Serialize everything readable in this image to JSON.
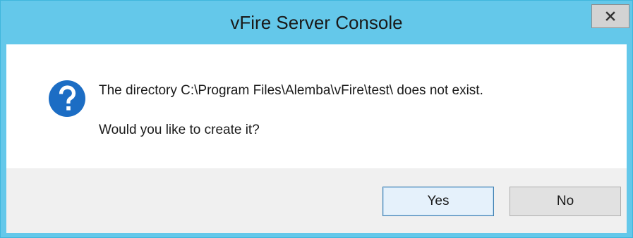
{
  "window": {
    "title": "vFire Server Console",
    "close_icon": "close-icon"
  },
  "dialog": {
    "icon": "question-icon",
    "message": "The directory C:\\Program Files\\Alemba\\vFire\\test\\ does not exist.",
    "question": "Would you like to create it?"
  },
  "buttons": {
    "yes_label": "Yes",
    "no_label": "No"
  },
  "colors": {
    "titlebar": "#64c8ea",
    "icon_blue": "#1c6dc4",
    "footer": "#f0f0f0",
    "default_button_border": "#3c7fb1"
  }
}
